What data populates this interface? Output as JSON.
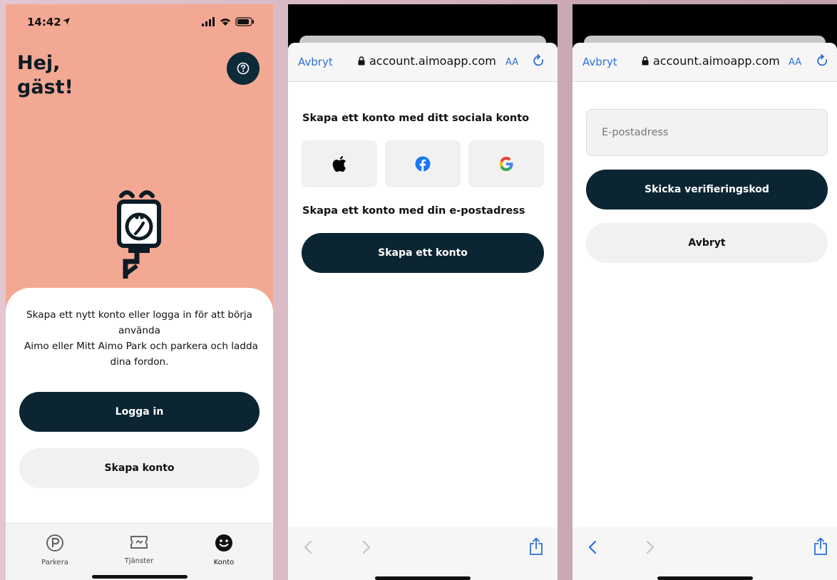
{
  "screen1": {
    "status_time": "14:42",
    "greeting_line1": "Hej,",
    "greeting_line2": "gäst!",
    "help_icon": "question-mark-icon",
    "intro_lines": [
      "Skapa ett nytt konto eller logga in för att börja",
      "använda",
      "Aimo eller Mitt Aimo Park och parkera och ladda",
      "dina fordon."
    ],
    "login_button": "Logga in",
    "create_button": "Skapa konto",
    "tabs": [
      {
        "label": "Parkera",
        "icon": "parking-icon"
      },
      {
        "label": "Tjänster",
        "icon": "ticket-icon"
      },
      {
        "label": "Konto",
        "icon": "smiley-icon"
      }
    ]
  },
  "screen2": {
    "cancel": "Avbryt",
    "url": "account.aimoapp.com",
    "text_size": "AA",
    "social_heading": "Skapa ett konto med ditt sociala konto",
    "social_providers": [
      "apple-icon",
      "facebook-icon",
      "google-icon"
    ],
    "email_heading": "Skapa ett konto med din e-postadress",
    "create_account_button": "Skapa ett konto"
  },
  "screen3": {
    "cancel": "Avbryt",
    "url": "account.aimoapp.com",
    "text_size": "AA",
    "email_placeholder": "E-postadress",
    "send_code_button": "Skicka verifieringskod",
    "cancel_button": "Avbryt"
  },
  "colors": {
    "accent_salmon": "#f3a893",
    "dark_navy": "#0b2533",
    "link_blue": "#2b71d6"
  }
}
